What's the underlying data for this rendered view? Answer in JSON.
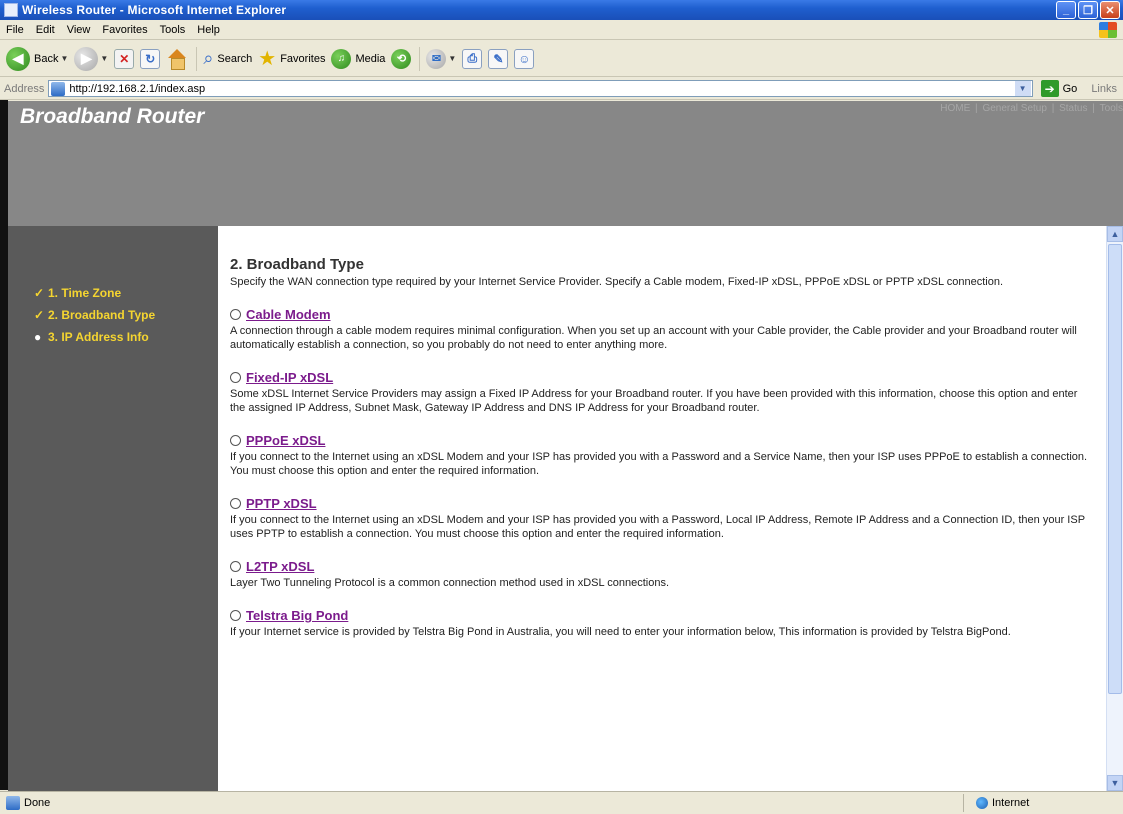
{
  "window": {
    "title": "Wireless Router - Microsoft Internet Explorer"
  },
  "menu": [
    "File",
    "Edit",
    "View",
    "Favorites",
    "Tools",
    "Help"
  ],
  "toolbar": {
    "back": "Back",
    "search": "Search",
    "favorites": "Favorites",
    "media": "Media"
  },
  "address": {
    "label": "Address",
    "url": "http://192.168.2.1/index.asp",
    "go": "Go",
    "links": "Links"
  },
  "header": {
    "brand": "Broadband Router",
    "nav": [
      "HOME",
      "General Setup",
      "Status",
      "Tools"
    ],
    "nav_sep": "|"
  },
  "sidebar": {
    "steps": [
      {
        "mark": "✓",
        "label": "1. Time Zone"
      },
      {
        "mark": "✓",
        "label": "2. Broadband Type"
      },
      {
        "mark": "●",
        "label": "3. IP Address Info"
      }
    ]
  },
  "content": {
    "title": "2. Broadband Type",
    "intro": "Specify the WAN connection type required by your Internet Service Provider. Specify a Cable modem, Fixed-IP xDSL, PPPoE xDSL or PPTP xDSL connection.",
    "options": [
      {
        "label": "Cable Modem",
        "desc": "A connection through a cable modem requires minimal configuration. When you set up an account with your Cable provider, the Cable provider and your Broadband router will automatically establish a connection, so you probably do not need to enter anything more."
      },
      {
        "label": "Fixed-IP xDSL",
        "desc": "Some xDSL Internet Service Providers may assign a Fixed IP Address for your Broadband router. If you have been provided with this information, choose this option and enter the assigned IP Address, Subnet Mask, Gateway IP Address and DNS IP Address for your Broadband router."
      },
      {
        "label": "PPPoE xDSL",
        "desc": "If you connect to the Internet using an xDSL Modem and your ISP has provided you with a Password and a Service Name, then your ISP uses PPPoE to establish a connection. You must choose this option and enter the required information."
      },
      {
        "label": "PPTP xDSL",
        "desc": "If you connect to the Internet using an xDSL Modem and your ISP has provided you with a Password, Local IP Address, Remote IP Address and a Connection ID, then your ISP uses PPTP to establish a connection. You must choose this option and enter the required information."
      },
      {
        "label": "L2TP xDSL",
        "desc": "Layer Two Tunneling Protocol is a common connection method used in xDSL connections."
      },
      {
        "label": "Telstra Big Pond",
        "desc": "If your Internet service is provided by Telstra Big Pond in Australia, you will need to enter your information below, This information is provided by Telstra BigPond."
      }
    ]
  },
  "status": {
    "left": "Done",
    "zone": "Internet"
  }
}
